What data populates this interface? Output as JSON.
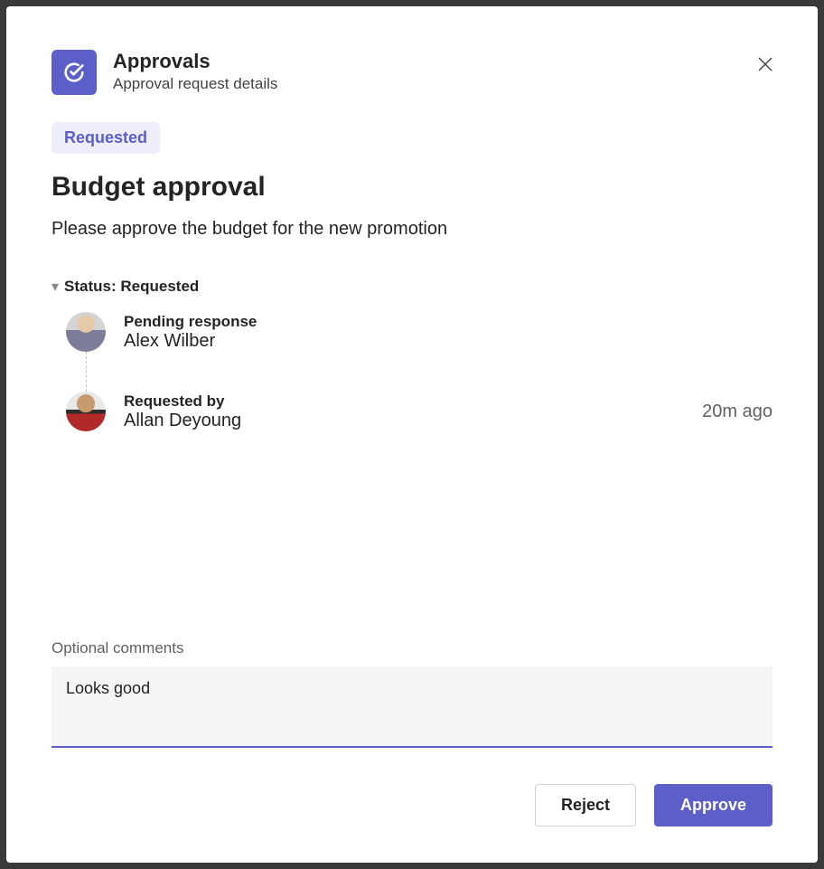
{
  "header": {
    "app_title": "Approvals",
    "subtitle": "Approval request details"
  },
  "status_pill": "Requested",
  "request": {
    "title": "Budget approval",
    "description": "Please approve the budget for the new promotion"
  },
  "status_section": {
    "label": "Status: Requested"
  },
  "people": [
    {
      "label": "Pending response",
      "name": "Alex Wilber",
      "timestamp": ""
    },
    {
      "label": "Requested by",
      "name": "Allan Deyoung",
      "timestamp": "20m ago"
    }
  ],
  "comments": {
    "label": "Optional comments",
    "value": "Looks good"
  },
  "actions": {
    "reject": "Reject",
    "approve": "Approve"
  }
}
